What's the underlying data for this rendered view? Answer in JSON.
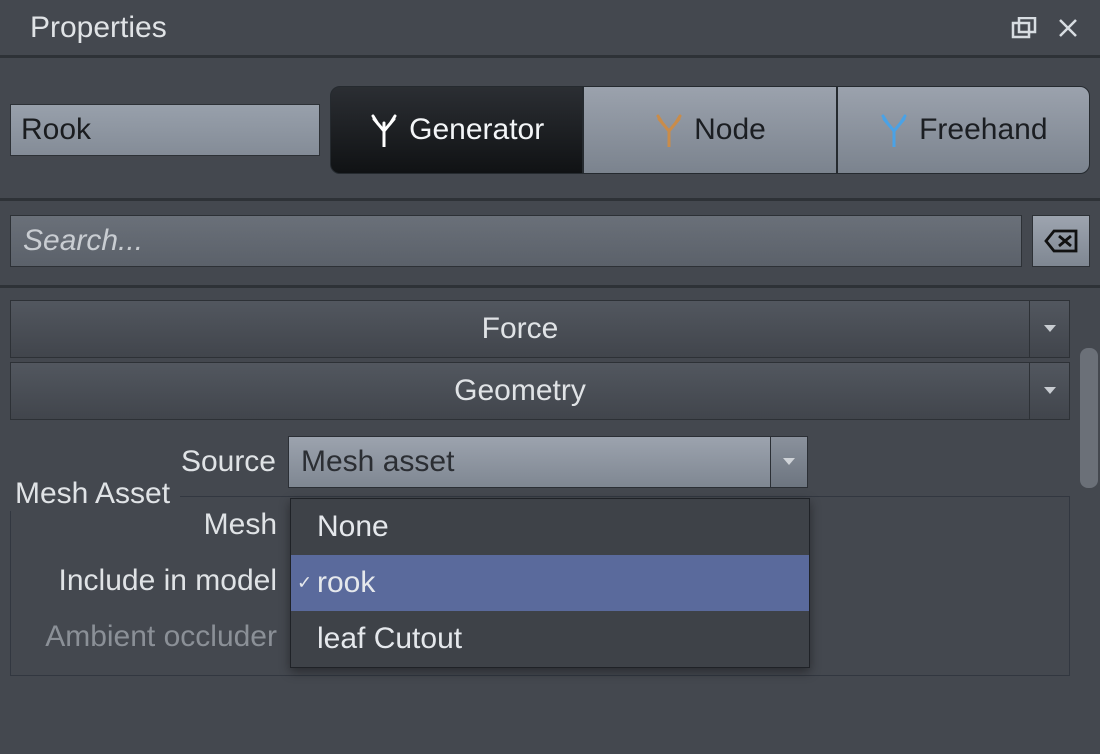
{
  "title": "Properties",
  "name_value": "Rook",
  "tabs": {
    "generator": "Generator",
    "node": "Node",
    "freehand": "Freehand"
  },
  "search_placeholder": "Search...",
  "sections": {
    "force": "Force",
    "geometry": "Geometry"
  },
  "geometry": {
    "source_label": "Source",
    "source_value": "Mesh asset",
    "group_title": "Mesh Asset",
    "mesh_label": "Mesh",
    "include_label": "Include in model",
    "ambient_label": "Ambient occluder"
  },
  "dropdown": {
    "options": [
      "None",
      "rook",
      "leaf Cutout"
    ],
    "selected_index": 1
  }
}
